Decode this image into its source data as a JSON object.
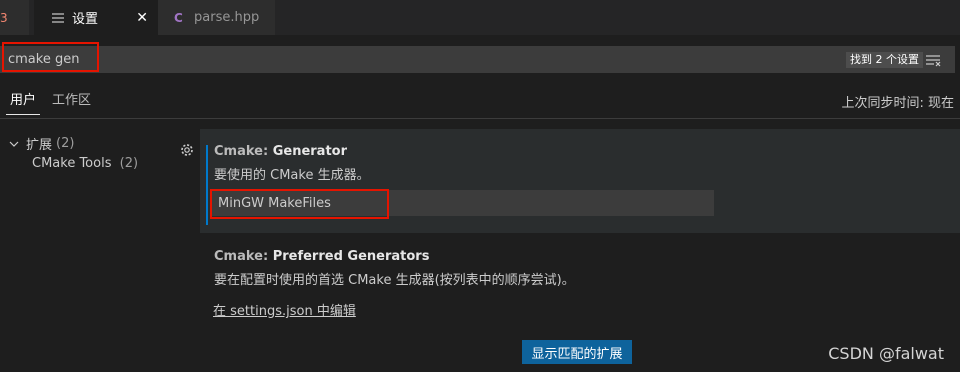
{
  "tabs": [
    {
      "label": "3"
    },
    {
      "label": "设置",
      "close": "✕"
    },
    {
      "label": "parse.hpp"
    }
  ],
  "search": {
    "value": "cmake gen",
    "count_badge": "找到 2 个设置"
  },
  "scope": {
    "user_tab": "用户",
    "workspace_tab": "工作区",
    "sync_status": "上次同步时间: 现在"
  },
  "toc": {
    "extensions": {
      "label": "扩展",
      "count": "(2)"
    },
    "cmake_tools": {
      "label": "CMake Tools",
      "count": "(2)"
    }
  },
  "settings": [
    {
      "category": "Cmake: ",
      "name": "Generator",
      "description": "要使用的 CMake 生成器。",
      "value": "MinGW MakeFiles"
    },
    {
      "category": "Cmake: ",
      "name": "Preferred Generators",
      "description": "要在配置时使用的首选 CMake 生成器(按列表中的顺序尝试)。",
      "link": "在 settings.json 中编辑"
    }
  ],
  "show_extensions_button": "显示匹配的扩展",
  "watermark": "CSDN @falwat",
  "colors": {
    "accent": "#007acc",
    "button": "#0e639c",
    "highlight_box": "#e51400"
  }
}
